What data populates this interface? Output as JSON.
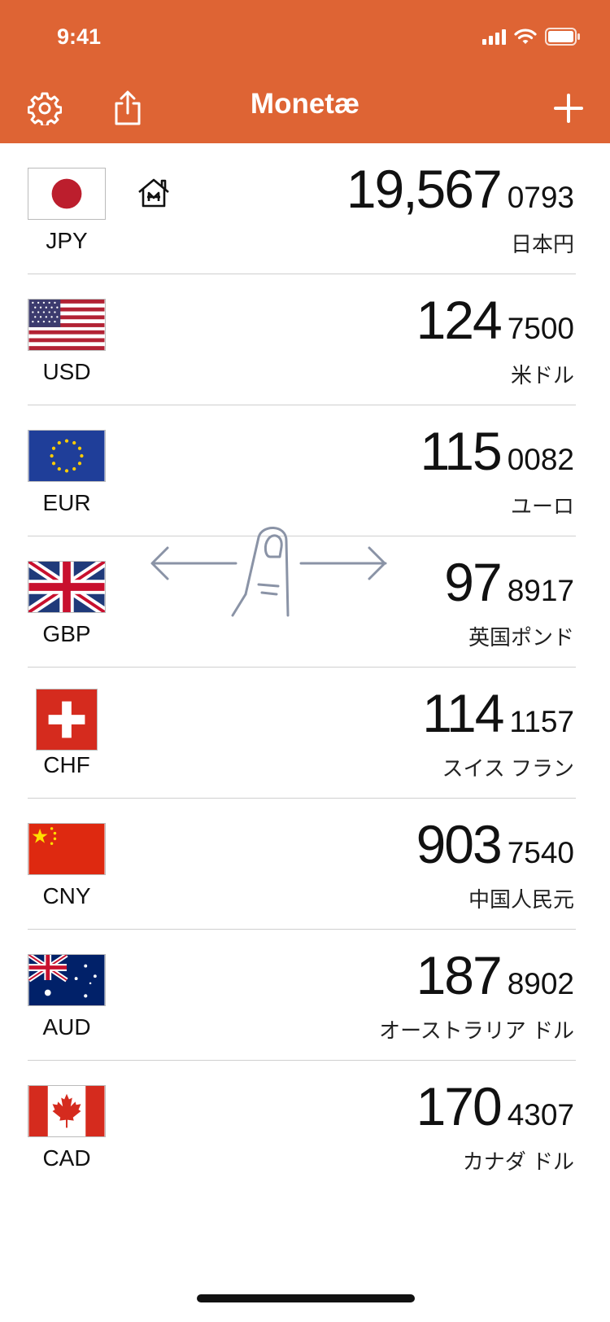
{
  "status": {
    "time": "9:41"
  },
  "header": {
    "title": "Monetæ",
    "settings_icon": "gear-icon",
    "share_icon": "share-icon",
    "add_icon": "plus-icon"
  },
  "colors": {
    "accent": "#de6434"
  },
  "rows": [
    {
      "code": "JPY",
      "int": "19,567",
      "frac": "0793",
      "name": "日本円",
      "flag": "jp",
      "home": true
    },
    {
      "code": "USD",
      "int": "124",
      "frac": "7500",
      "name": "米ドル",
      "flag": "us"
    },
    {
      "code": "EUR",
      "int": "115",
      "frac": "0082",
      "name": "ユーロ",
      "flag": "eu"
    },
    {
      "code": "GBP",
      "int": "97",
      "frac": "8917",
      "name": "英国ポンド",
      "flag": "gb"
    },
    {
      "code": "CHF",
      "int": "114",
      "frac": "1157",
      "name": "スイス フラン",
      "flag": "ch"
    },
    {
      "code": "CNY",
      "int": "903",
      "frac": "7540",
      "name": "中国人民元",
      "flag": "cn"
    },
    {
      "code": "AUD",
      "int": "187",
      "frac": "8902",
      "name": "オーストラリア ドル",
      "flag": "au"
    },
    {
      "code": "CAD",
      "int": "170",
      "frac": "4307",
      "name": "カナダ ドル",
      "flag": "ca"
    }
  ]
}
